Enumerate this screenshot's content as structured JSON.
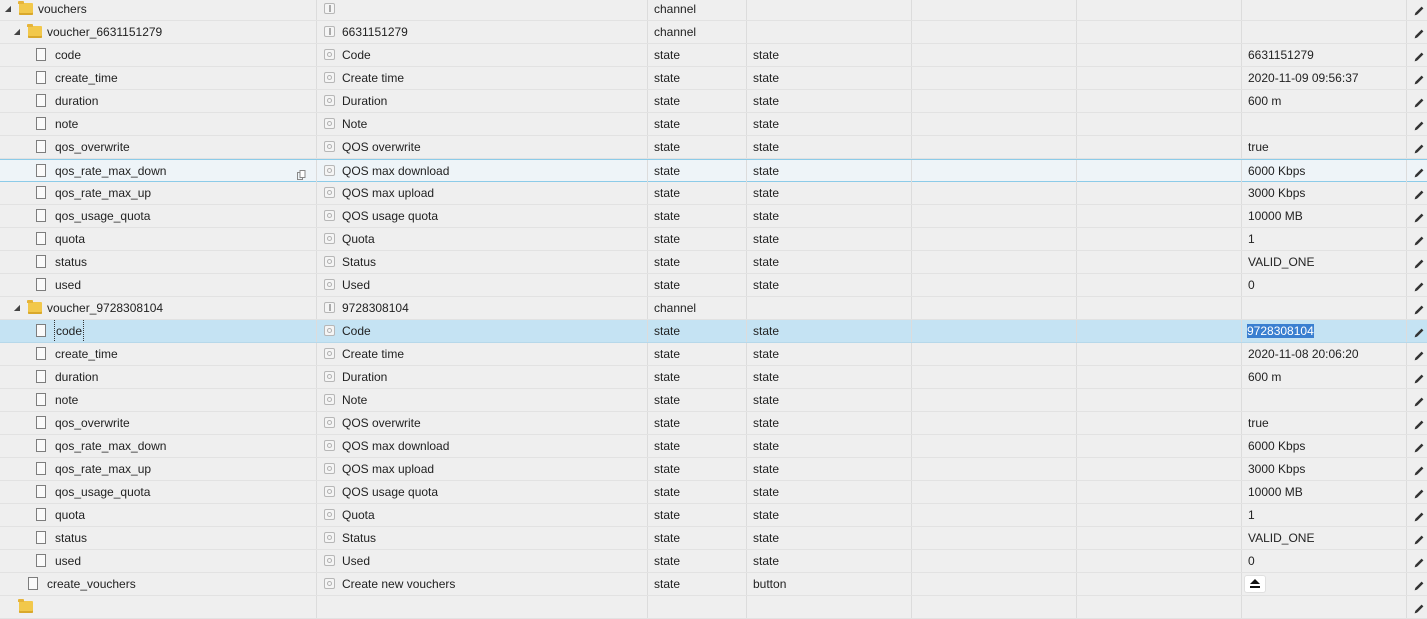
{
  "rows": [
    {
      "id": "vouchers",
      "name": "",
      "type": "channel",
      "role": "",
      "value": "",
      "level": 0,
      "kind": "folder",
      "toggle": "expanded"
    },
    {
      "id": "voucher_6631151279",
      "name": "6631151279",
      "type": "channel",
      "role": "",
      "value": "",
      "level": 1,
      "kind": "folder",
      "toggle": "expanded"
    },
    {
      "id": "code",
      "name": "Code",
      "type": "state",
      "role": "state",
      "value": "6631151279",
      "level": 2,
      "kind": "file"
    },
    {
      "id": "create_time",
      "name": "Create time",
      "type": "state",
      "role": "state",
      "value": "2020-11-09 09:56:37",
      "level": 2,
      "kind": "file"
    },
    {
      "id": "duration",
      "name": "Duration",
      "type": "state",
      "role": "state",
      "value": "600 m",
      "level": 2,
      "kind": "file"
    },
    {
      "id": "note",
      "name": "Note",
      "type": "state",
      "role": "state",
      "value": "",
      "level": 2,
      "kind": "file"
    },
    {
      "id": "qos_overwrite",
      "name": "QOS overwrite",
      "type": "state",
      "role": "state",
      "value": "true",
      "level": 2,
      "kind": "file"
    },
    {
      "id": "qos_rate_max_down",
      "name": "QOS max download",
      "type": "state",
      "role": "state",
      "value": "6000 Kbps",
      "level": 2,
      "kind": "file",
      "state": "hover"
    },
    {
      "id": "qos_rate_max_up",
      "name": "QOS max upload",
      "type": "state",
      "role": "state",
      "value": "3000 Kbps",
      "level": 2,
      "kind": "file"
    },
    {
      "id": "qos_usage_quota",
      "name": "QOS usage quota",
      "type": "state",
      "role": "state",
      "value": "10000 MB",
      "level": 2,
      "kind": "file"
    },
    {
      "id": "quota",
      "name": "Quota",
      "type": "state",
      "role": "state",
      "value": "1",
      "level": 2,
      "kind": "file"
    },
    {
      "id": "status",
      "name": "Status",
      "type": "state",
      "role": "state",
      "value": "VALID_ONE",
      "level": 2,
      "kind": "file"
    },
    {
      "id": "used",
      "name": "Used",
      "type": "state",
      "role": "state",
      "value": "0",
      "level": 2,
      "kind": "file"
    },
    {
      "id": "voucher_9728308104",
      "name": "9728308104",
      "type": "channel",
      "role": "",
      "value": "",
      "level": 1,
      "kind": "folder",
      "toggle": "expanded"
    },
    {
      "id": "code",
      "name": "Code",
      "type": "state",
      "role": "state",
      "value": "9728308104",
      "level": 2,
      "kind": "file",
      "state": "selected"
    },
    {
      "id": "create_time",
      "name": "Create time",
      "type": "state",
      "role": "state",
      "value": "2020-11-08 20:06:20",
      "level": 2,
      "kind": "file"
    },
    {
      "id": "duration",
      "name": "Duration",
      "type": "state",
      "role": "state",
      "value": "600 m",
      "level": 2,
      "kind": "file"
    },
    {
      "id": "note",
      "name": "Note",
      "type": "state",
      "role": "state",
      "value": "",
      "level": 2,
      "kind": "file"
    },
    {
      "id": "qos_overwrite",
      "name": "QOS overwrite",
      "type": "state",
      "role": "state",
      "value": "true",
      "level": 2,
      "kind": "file"
    },
    {
      "id": "qos_rate_max_down",
      "name": "QOS max download",
      "type": "state",
      "role": "state",
      "value": "6000 Kbps",
      "level": 2,
      "kind": "file"
    },
    {
      "id": "qos_rate_max_up",
      "name": "QOS max upload",
      "type": "state",
      "role": "state",
      "value": "3000 Kbps",
      "level": 2,
      "kind": "file"
    },
    {
      "id": "qos_usage_quota",
      "name": "QOS usage quota",
      "type": "state",
      "role": "state",
      "value": "10000 MB",
      "level": 2,
      "kind": "file"
    },
    {
      "id": "quota",
      "name": "Quota",
      "type": "state",
      "role": "state",
      "value": "1",
      "level": 2,
      "kind": "file"
    },
    {
      "id": "status",
      "name": "Status",
      "type": "state",
      "role": "state",
      "value": "VALID_ONE",
      "level": 2,
      "kind": "file"
    },
    {
      "id": "used",
      "name": "Used",
      "type": "state",
      "role": "state",
      "value": "0",
      "level": 2,
      "kind": "file"
    },
    {
      "id": "create_vouchers",
      "name": "Create new vouchers",
      "type": "state",
      "role": "button",
      "value": "",
      "level": 1,
      "kind": "file",
      "valueIcon": "eject-icon"
    },
    {
      "id": "",
      "name": "",
      "type": "",
      "role": "",
      "value": "",
      "level": 0,
      "kind": "folder"
    }
  ],
  "icons": {
    "folder": "folder-icon",
    "file": "file-icon",
    "edit": "pencil-icon",
    "copy": "copy-icon",
    "expand": "expand-toggle-icon"
  },
  "colors": {
    "background": "#efefef",
    "hover_border": "#8ccbe8",
    "selected_row": "#c5e3f3",
    "text_highlight": "#3a7fd0",
    "folder": "#f2c84b"
  }
}
